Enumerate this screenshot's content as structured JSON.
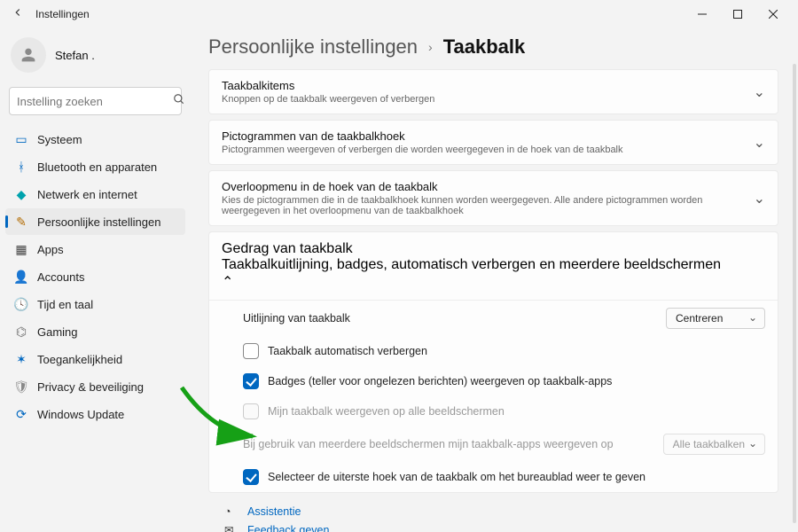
{
  "window_title": "Instellingen",
  "user": {
    "name": "Stefan ."
  },
  "search": {
    "placeholder": "Instelling zoeken"
  },
  "nav": [
    {
      "label": "Systeem",
      "icon_color": "#0067c0",
      "active": false
    },
    {
      "label": "Bluetooth en apparaten",
      "icon_color": "#0067c0",
      "active": false
    },
    {
      "label": "Netwerk en internet",
      "icon_color": "#00a2ad",
      "active": false
    },
    {
      "label": "Persoonlijke instellingen",
      "icon_color": "#b36b00",
      "active": true
    },
    {
      "label": "Apps",
      "icon_color": "#444",
      "active": false
    },
    {
      "label": "Accounts",
      "icon_color": "#c09000",
      "active": false
    },
    {
      "label": "Tijd en taal",
      "icon_color": "#0067c0",
      "active": false
    },
    {
      "label": "Gaming",
      "icon_color": "#777",
      "active": false
    },
    {
      "label": "Toegankelijkheid",
      "icon_color": "#0067c0",
      "active": false
    },
    {
      "label": "Privacy & beveiliging",
      "icon_color": "#888",
      "active": false
    },
    {
      "label": "Windows Update",
      "icon_color": "#0067c0",
      "active": false
    }
  ],
  "breadcrumb": {
    "parent": "Persoonlijke instellingen",
    "current": "Taakbalk"
  },
  "sections": {
    "items": {
      "title": "Taakbalkitems",
      "desc": "Knoppen op de taakbalk weergeven of verbergen"
    },
    "corner_icons": {
      "title": "Pictogrammen van de taakbalkhoek",
      "desc": "Pictogrammen weergeven of verbergen die worden weergegeven in de hoek van de taakbalk"
    },
    "overflow": {
      "title": "Overloopmenu in de hoek van de taakbalk",
      "desc": "Kies de pictogrammen die in de taakbalkhoek kunnen worden weergegeven. Alle andere pictogrammen worden weergegeven in het overloopmenu van de taakbalkhoek"
    },
    "behavior": {
      "title": "Gedrag van taakbalk",
      "desc": "Taakbalkuitlijning, badges, automatisch verbergen en meerdere beeldschermen"
    }
  },
  "behavior": {
    "alignment_label": "Uitlijning van taakbalk",
    "alignment_value": "Centreren",
    "auto_hide": "Taakbalk automatisch verbergen",
    "badges": "Badges (teller voor ongelezen berichten) weergeven op taakbalk-apps",
    "multi_display": "Mijn taakbalk weergeven op alle beeldschermen",
    "multi_apps_label": "Bij gebruik van meerdere beeldschermen mijn taakbalk-apps weergeven op",
    "multi_apps_value": "Alle taakbalken",
    "show_desktop": "Selecteer de uiterste hoek van de taakbalk om het bureaublad weer te geven"
  },
  "footer": {
    "help": "Assistentie",
    "feedback": "Feedback geven"
  }
}
